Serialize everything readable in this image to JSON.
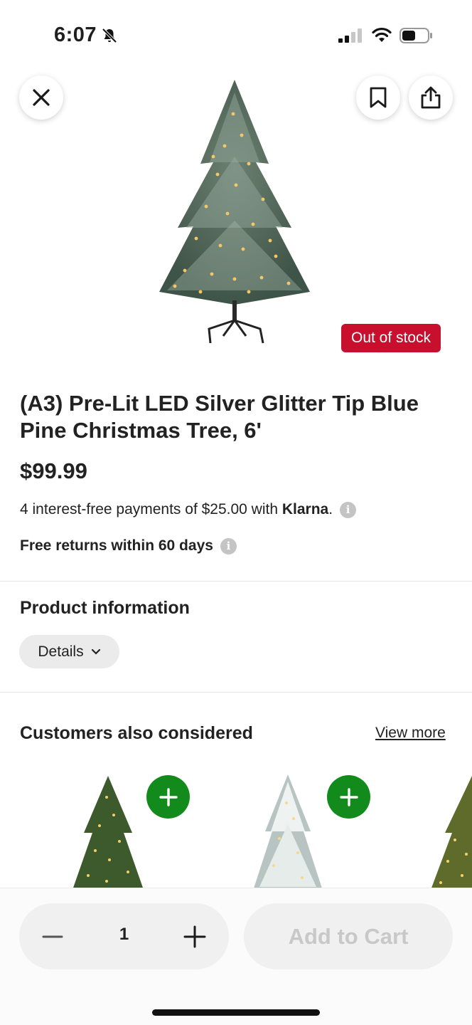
{
  "status_bar": {
    "time": "6:07",
    "icons": [
      "bell-slash-icon",
      "cellular-signal-icon",
      "wifi-icon",
      "battery-icon"
    ]
  },
  "hero": {
    "close_icon": "close-icon",
    "bookmark_icon": "bookmark-icon",
    "share_icon": "share-icon",
    "product_image": "christmas-tree-image",
    "stock_badge": "Out of stock"
  },
  "product": {
    "title": "(A3) Pre-Lit LED Silver Glitter Tip Blue Pine Christmas Tree, 6'",
    "price": "$99.99",
    "klarna_prefix": "4 interest-free payments of $25.00 with ",
    "klarna_brand": "Klarna",
    "klarna_suffix": ".",
    "returns": "Free returns within 60 days"
  },
  "product_info": {
    "heading": "Product information",
    "details_label": "Details"
  },
  "recommendations": {
    "heading": "Customers also considered",
    "view_more": "View more",
    "items": [
      {
        "image": "green-lit-tree-image"
      },
      {
        "image": "flocked-white-tree-image"
      },
      {
        "image": "gold-lit-tree-image"
      }
    ]
  },
  "bottom_bar": {
    "quantity": "1",
    "add_to_cart": "Add to Cart"
  },
  "colors": {
    "out_of_stock": "#c8102e",
    "add_green": "#138a1c",
    "disabled_text": "#c8c8c8"
  }
}
